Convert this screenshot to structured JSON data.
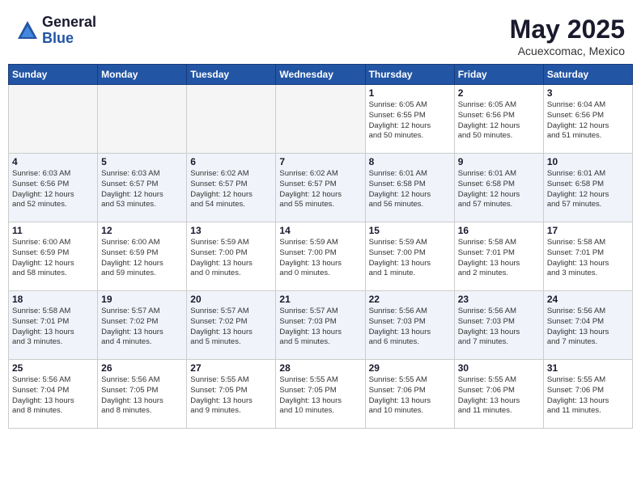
{
  "header": {
    "logo_general": "General",
    "logo_blue": "Blue",
    "month_year": "May 2025",
    "location": "Acuexcomac, Mexico"
  },
  "days_of_week": [
    "Sunday",
    "Monday",
    "Tuesday",
    "Wednesday",
    "Thursday",
    "Friday",
    "Saturday"
  ],
  "weeks": [
    [
      {
        "day": "",
        "info": ""
      },
      {
        "day": "",
        "info": ""
      },
      {
        "day": "",
        "info": ""
      },
      {
        "day": "",
        "info": ""
      },
      {
        "day": "1",
        "info": "Sunrise: 6:05 AM\nSunset: 6:55 PM\nDaylight: 12 hours\nand 50 minutes."
      },
      {
        "day": "2",
        "info": "Sunrise: 6:05 AM\nSunset: 6:56 PM\nDaylight: 12 hours\nand 50 minutes."
      },
      {
        "day": "3",
        "info": "Sunrise: 6:04 AM\nSunset: 6:56 PM\nDaylight: 12 hours\nand 51 minutes."
      }
    ],
    [
      {
        "day": "4",
        "info": "Sunrise: 6:03 AM\nSunset: 6:56 PM\nDaylight: 12 hours\nand 52 minutes."
      },
      {
        "day": "5",
        "info": "Sunrise: 6:03 AM\nSunset: 6:57 PM\nDaylight: 12 hours\nand 53 minutes."
      },
      {
        "day": "6",
        "info": "Sunrise: 6:02 AM\nSunset: 6:57 PM\nDaylight: 12 hours\nand 54 minutes."
      },
      {
        "day": "7",
        "info": "Sunrise: 6:02 AM\nSunset: 6:57 PM\nDaylight: 12 hours\nand 55 minutes."
      },
      {
        "day": "8",
        "info": "Sunrise: 6:01 AM\nSunset: 6:58 PM\nDaylight: 12 hours\nand 56 minutes."
      },
      {
        "day": "9",
        "info": "Sunrise: 6:01 AM\nSunset: 6:58 PM\nDaylight: 12 hours\nand 57 minutes."
      },
      {
        "day": "10",
        "info": "Sunrise: 6:01 AM\nSunset: 6:58 PM\nDaylight: 12 hours\nand 57 minutes."
      }
    ],
    [
      {
        "day": "11",
        "info": "Sunrise: 6:00 AM\nSunset: 6:59 PM\nDaylight: 12 hours\nand 58 minutes."
      },
      {
        "day": "12",
        "info": "Sunrise: 6:00 AM\nSunset: 6:59 PM\nDaylight: 12 hours\nand 59 minutes."
      },
      {
        "day": "13",
        "info": "Sunrise: 5:59 AM\nSunset: 7:00 PM\nDaylight: 13 hours\nand 0 minutes."
      },
      {
        "day": "14",
        "info": "Sunrise: 5:59 AM\nSunset: 7:00 PM\nDaylight: 13 hours\nand 0 minutes."
      },
      {
        "day": "15",
        "info": "Sunrise: 5:59 AM\nSunset: 7:00 PM\nDaylight: 13 hours\nand 1 minute."
      },
      {
        "day": "16",
        "info": "Sunrise: 5:58 AM\nSunset: 7:01 PM\nDaylight: 13 hours\nand 2 minutes."
      },
      {
        "day": "17",
        "info": "Sunrise: 5:58 AM\nSunset: 7:01 PM\nDaylight: 13 hours\nand 3 minutes."
      }
    ],
    [
      {
        "day": "18",
        "info": "Sunrise: 5:58 AM\nSunset: 7:01 PM\nDaylight: 13 hours\nand 3 minutes."
      },
      {
        "day": "19",
        "info": "Sunrise: 5:57 AM\nSunset: 7:02 PM\nDaylight: 13 hours\nand 4 minutes."
      },
      {
        "day": "20",
        "info": "Sunrise: 5:57 AM\nSunset: 7:02 PM\nDaylight: 13 hours\nand 5 minutes."
      },
      {
        "day": "21",
        "info": "Sunrise: 5:57 AM\nSunset: 7:03 PM\nDaylight: 13 hours\nand 5 minutes."
      },
      {
        "day": "22",
        "info": "Sunrise: 5:56 AM\nSunset: 7:03 PM\nDaylight: 13 hours\nand 6 minutes."
      },
      {
        "day": "23",
        "info": "Sunrise: 5:56 AM\nSunset: 7:03 PM\nDaylight: 13 hours\nand 7 minutes."
      },
      {
        "day": "24",
        "info": "Sunrise: 5:56 AM\nSunset: 7:04 PM\nDaylight: 13 hours\nand 7 minutes."
      }
    ],
    [
      {
        "day": "25",
        "info": "Sunrise: 5:56 AM\nSunset: 7:04 PM\nDaylight: 13 hours\nand 8 minutes."
      },
      {
        "day": "26",
        "info": "Sunrise: 5:56 AM\nSunset: 7:05 PM\nDaylight: 13 hours\nand 8 minutes."
      },
      {
        "day": "27",
        "info": "Sunrise: 5:55 AM\nSunset: 7:05 PM\nDaylight: 13 hours\nand 9 minutes."
      },
      {
        "day": "28",
        "info": "Sunrise: 5:55 AM\nSunset: 7:05 PM\nDaylight: 13 hours\nand 10 minutes."
      },
      {
        "day": "29",
        "info": "Sunrise: 5:55 AM\nSunset: 7:06 PM\nDaylight: 13 hours\nand 10 minutes."
      },
      {
        "day": "30",
        "info": "Sunrise: 5:55 AM\nSunset: 7:06 PM\nDaylight: 13 hours\nand 11 minutes."
      },
      {
        "day": "31",
        "info": "Sunrise: 5:55 AM\nSunset: 7:06 PM\nDaylight: 13 hours\nand 11 minutes."
      }
    ]
  ]
}
